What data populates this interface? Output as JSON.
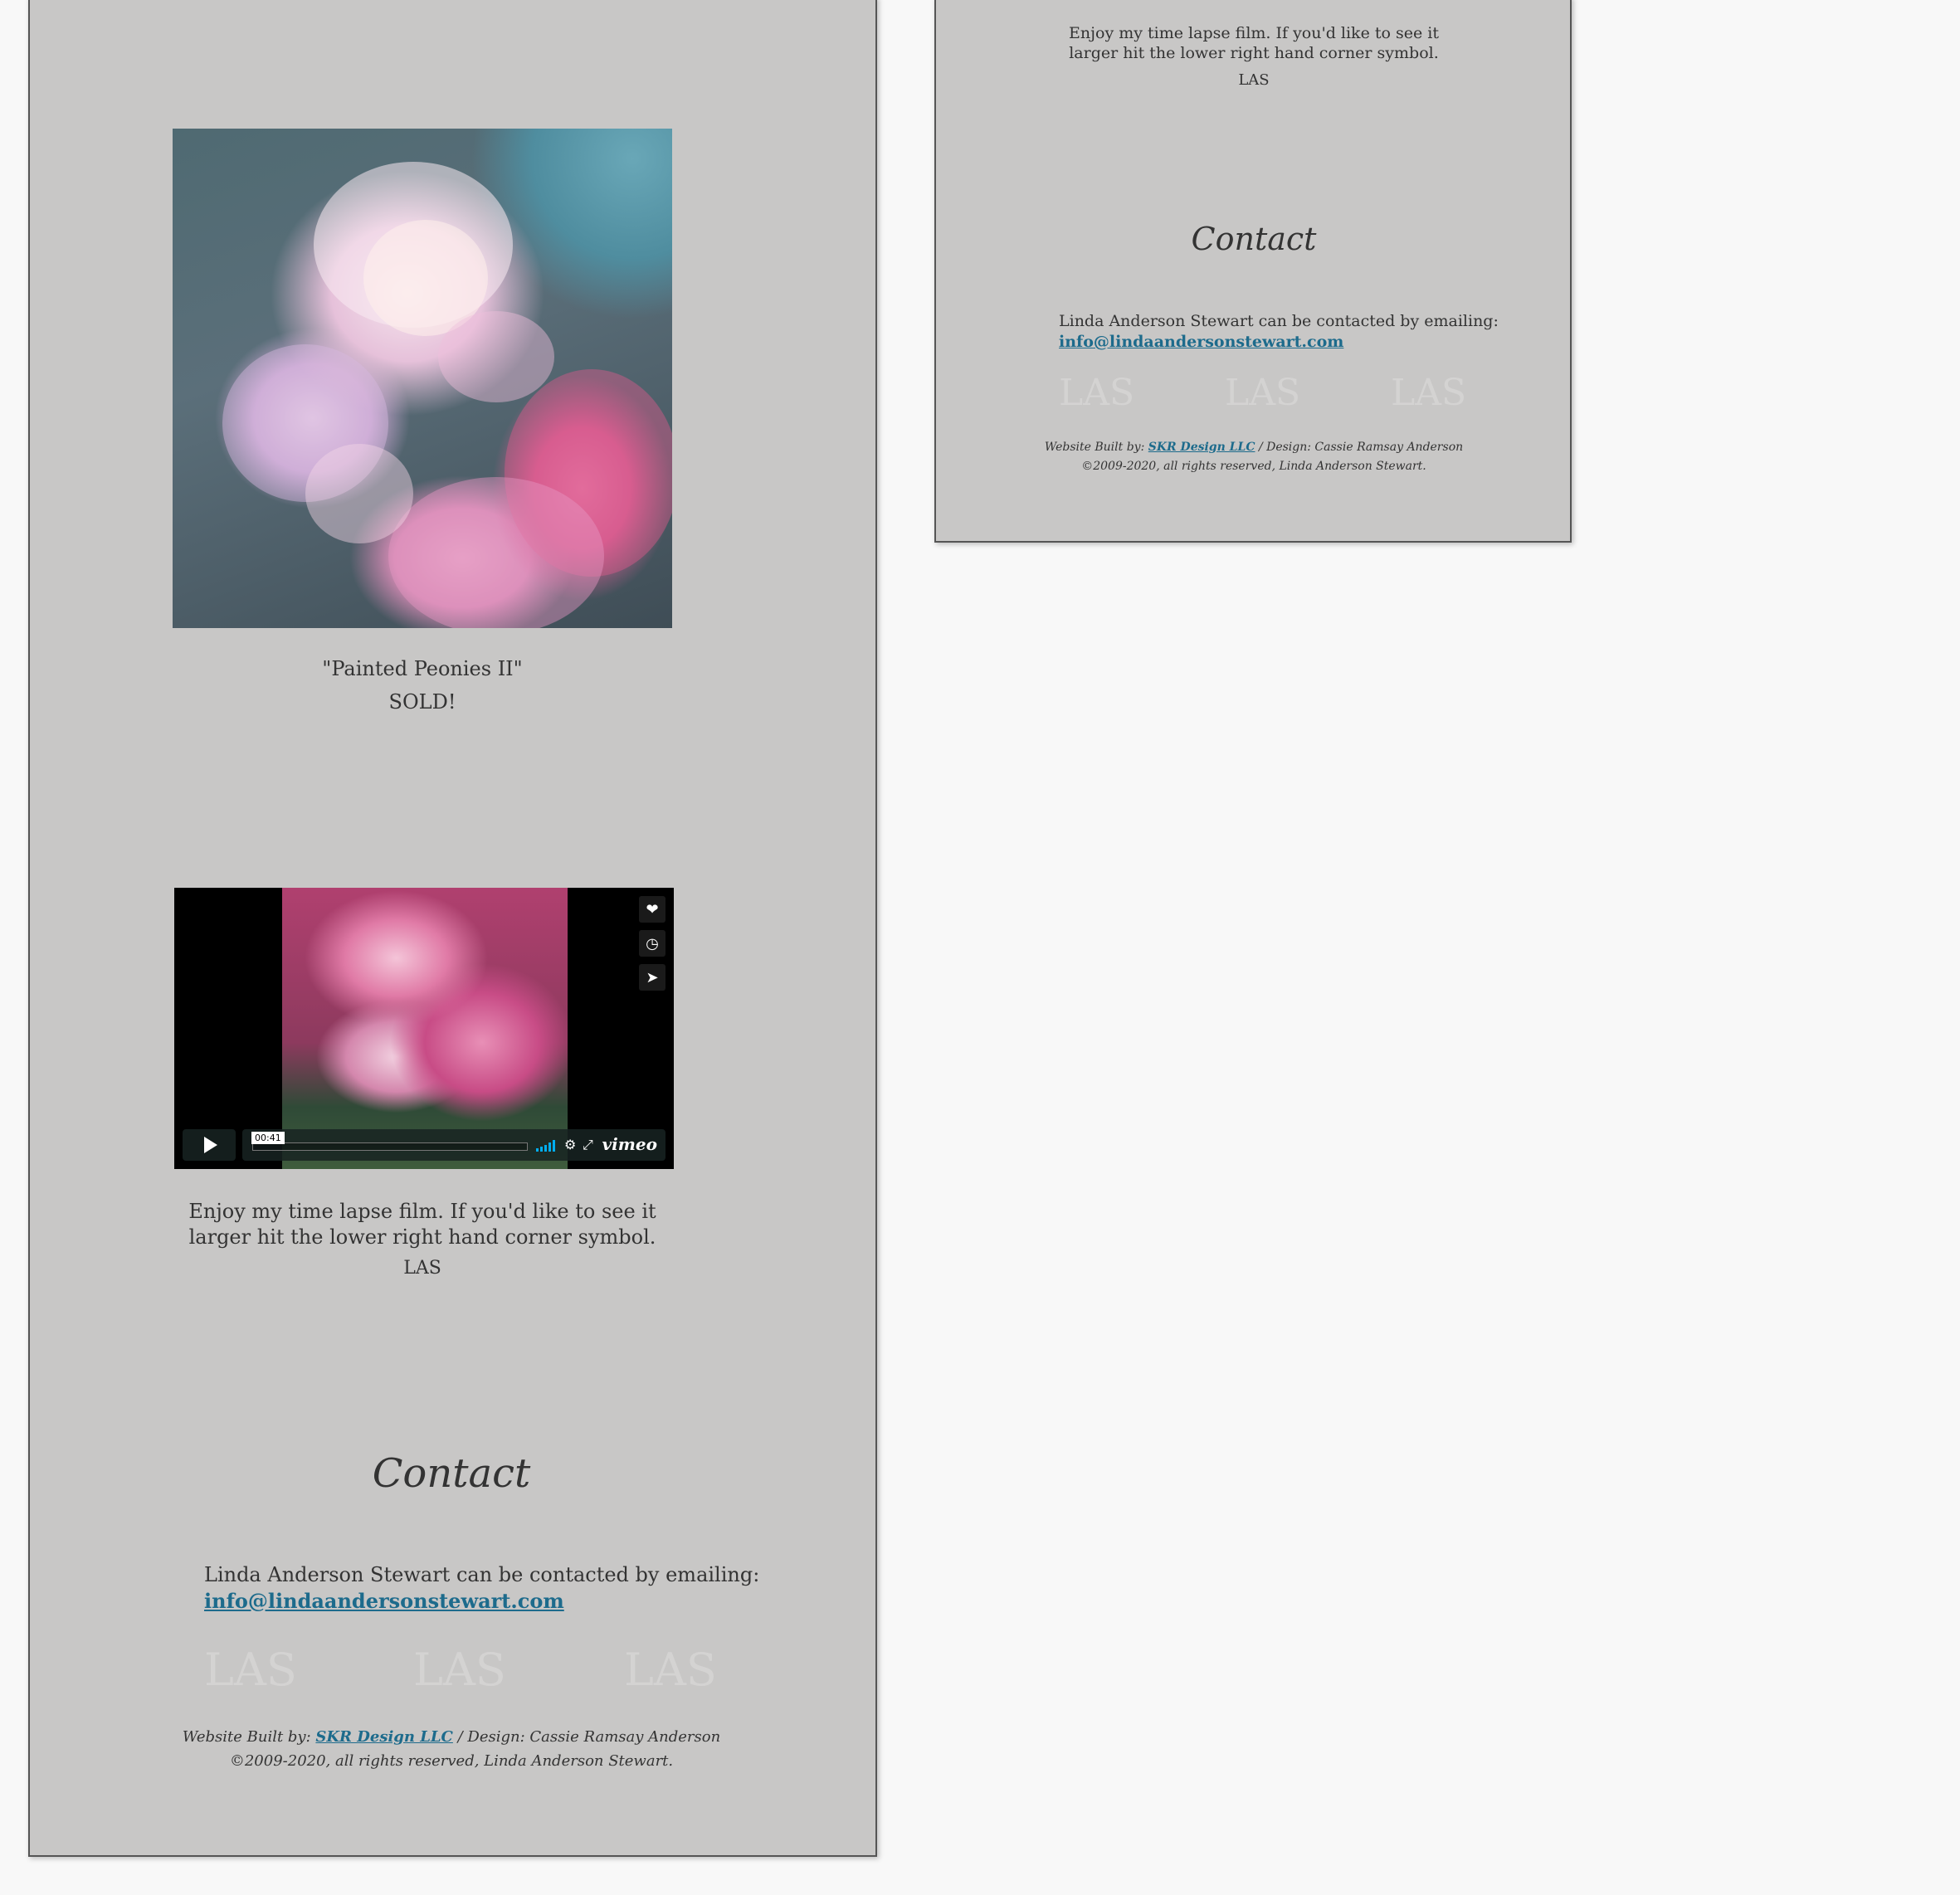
{
  "left": {
    "painting": {
      "title": "\"Painted Peonies II\"",
      "status": "SOLD!"
    },
    "video": {
      "timecode": "00:41",
      "brand": "vimeo"
    },
    "video_caption": "Enjoy my time lapse film. If you'd like to see it larger hit the lower right hand corner symbol.",
    "signature": "LAS",
    "contact_heading": "Contact",
    "contact_text": "Linda Anderson Stewart can be contacted by emailing:",
    "email": "info@lindaandersonstewart.com",
    "watermarks": [
      "LAS",
      "LAS",
      "LAS"
    ],
    "footer_prefix": "Website Built by:",
    "footer_link": "SKR Design LLC",
    "footer_design": "/ Design: Cassie Ramsay Anderson",
    "footer_copyright": "©2009-2020, all rights reserved, Linda Anderson Stewart."
  },
  "right": {
    "video_caption": "Enjoy my time lapse film. If you'd like to see it larger hit the lower right hand corner symbol.",
    "signature": "LAS",
    "contact_heading": "Contact",
    "contact_text": "Linda Anderson Stewart can be contacted by emailing:",
    "email": "info@lindaandersonstewart.com",
    "watermarks": [
      "LAS",
      "LAS",
      "LAS"
    ],
    "footer_prefix": "Website Built by:",
    "footer_link": "SKR Design LLC",
    "footer_design": "/ Design: Cassie Ramsay Anderson",
    "footer_copyright": "©2009-2020, all rights reserved, Linda Anderson Stewart."
  },
  "icons": {
    "like": "heart-icon",
    "watch_later": "clock-icon",
    "share": "paper-plane-icon",
    "play": "play-icon",
    "settings": "gear-icon",
    "fullscreen": "fullscreen-icon",
    "volume": "volume-icon"
  },
  "colors": {
    "page_bg": "#f8f8f8",
    "panel_bg": "#c8c7c6",
    "link": "#1d6b8c",
    "text": "#333333",
    "volume": "#00adef"
  }
}
